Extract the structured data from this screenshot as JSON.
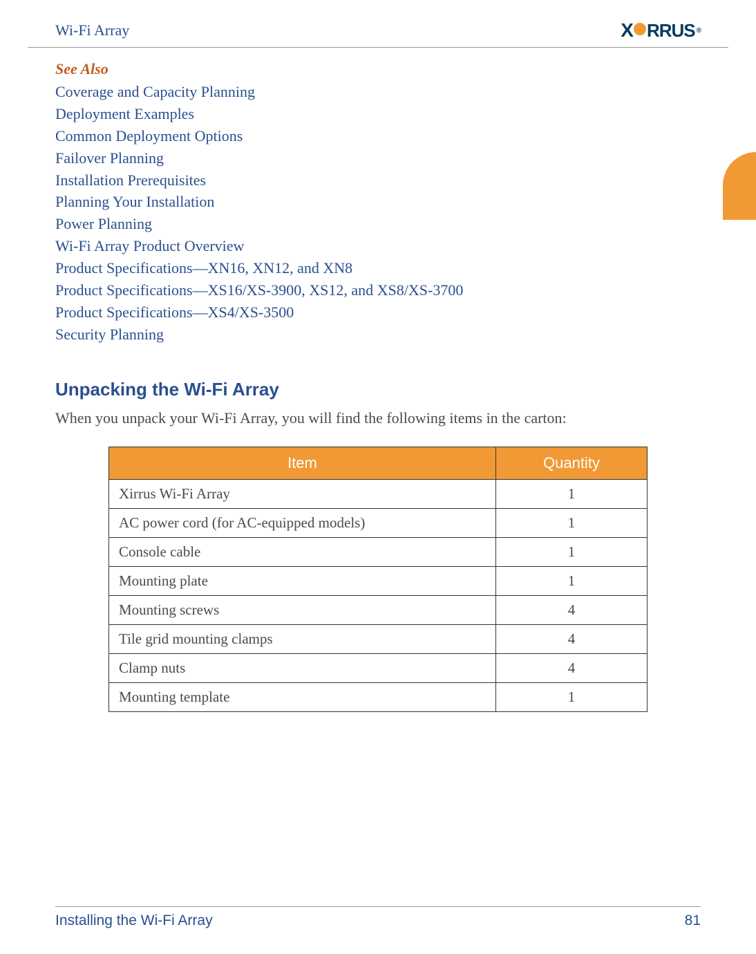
{
  "header": {
    "title": "Wi-Fi Array",
    "logo_text_1": "X",
    "logo_text_2": "RRUS",
    "logo_reg": "®"
  },
  "see_also": {
    "title": "See Also",
    "links": [
      "Coverage and Capacity Planning",
      "Deployment Examples",
      "Common Deployment Options",
      "Failover Planning",
      "Installation Prerequisites",
      "Planning Your Installation",
      "Power Planning",
      "Wi-Fi Array Product Overview",
      "Product Specifications—XN16, XN12, and XN8",
      "Product Specifications—XS16/XS-3900, XS12, and XS8/XS-3700",
      "Product Specifications—XS4/XS-3500",
      "Security Planning"
    ]
  },
  "section": {
    "heading": "Unpacking the Wi-Fi Array",
    "body": "When you unpack your Wi-Fi Array, you will find the following items in the carton:"
  },
  "table": {
    "headers": {
      "item": "Item",
      "qty": "Quantity"
    },
    "rows": [
      {
        "item": "Xirrus Wi-Fi Array",
        "qty": "1"
      },
      {
        "item": "AC power cord (for AC-equipped models)",
        "qty": "1"
      },
      {
        "item": "Console cable",
        "qty": "1"
      },
      {
        "item": "Mounting plate",
        "qty": "1"
      },
      {
        "item": "Mounting screws",
        "qty": "4"
      },
      {
        "item": "Tile grid mounting clamps",
        "qty": "4"
      },
      {
        "item": "Clamp nuts",
        "qty": "4"
      },
      {
        "item": "Mounting template",
        "qty": "1"
      }
    ]
  },
  "footer": {
    "title": "Installing the Wi-Fi Array",
    "page": "81"
  }
}
